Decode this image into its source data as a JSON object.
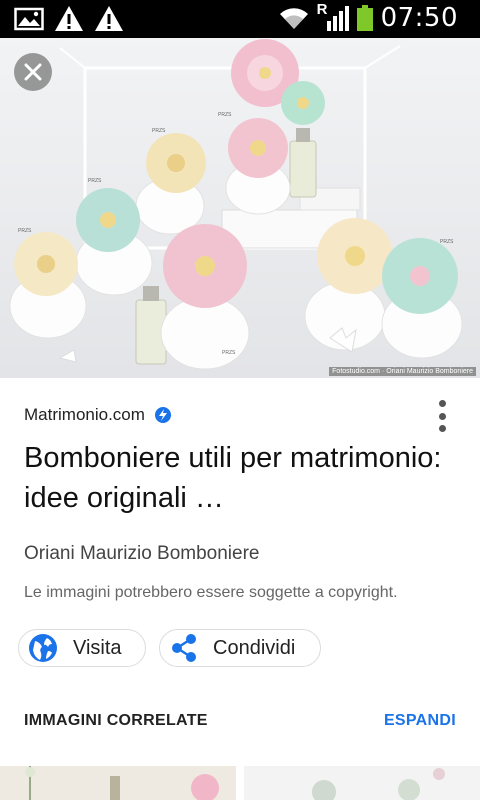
{
  "status_bar": {
    "time": "07:50",
    "roaming": "R",
    "icons": [
      "image-icon",
      "warning-icon",
      "warning-icon",
      "wifi-icon",
      "signal-icon",
      "battery-icon"
    ]
  },
  "image": {
    "credit": "Fotostudio.com · Oriani Maurizio Bomboniere",
    "label_code": "PRZS"
  },
  "result": {
    "source": "Matrimonio.com",
    "title": "Bomboniere utili per matrimonio: idee originali …",
    "site_name": "Oriani Maurizio Bomboniere",
    "copyright_note": "Le immagini potrebbero essere soggette a copyright."
  },
  "actions": {
    "visit_label": "Visita",
    "share_label": "Condividi"
  },
  "related": {
    "title": "IMMAGINI CORRELATE",
    "expand_label": "ESPANDI"
  },
  "colors": {
    "accent": "#1a73e8",
    "battery": "#7ec82a"
  }
}
